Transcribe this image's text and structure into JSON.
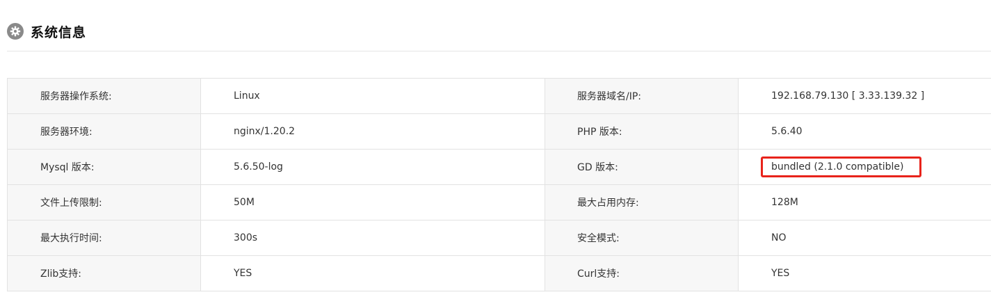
{
  "section": {
    "title": "系统信息",
    "icon": "gear-icon"
  },
  "info_table": {
    "rows": [
      {
        "label1": "服务器操作系统:",
        "value1": "Linux",
        "label2": "服务器域名/IP:",
        "value2": "192.168.79.130 [ 3.33.139.32 ]"
      },
      {
        "label1": "服务器环境:",
        "value1": "nginx/1.20.2",
        "label2": "PHP 版本:",
        "value2": "5.6.40"
      },
      {
        "label1": "Mysql 版本:",
        "value1": "5.6.50-log",
        "label2": "GD 版本:",
        "value2": "bundled (2.1.0 compatible)"
      },
      {
        "label1": "文件上传限制:",
        "value1": "50M",
        "label2": "最大占用内存:",
        "value2": "128M"
      },
      {
        "label1": "最大执行时间:",
        "value1": "300s",
        "label2": "安全模式:",
        "value2": "NO"
      },
      {
        "label1": "Zlib支持:",
        "value1": "YES",
        "label2": "Curl支持:",
        "value2": "YES"
      }
    ]
  },
  "colors": {
    "highlight_border": "#e8231b",
    "label_bg": "#f7f7f7",
    "border": "#e2e2e2"
  }
}
